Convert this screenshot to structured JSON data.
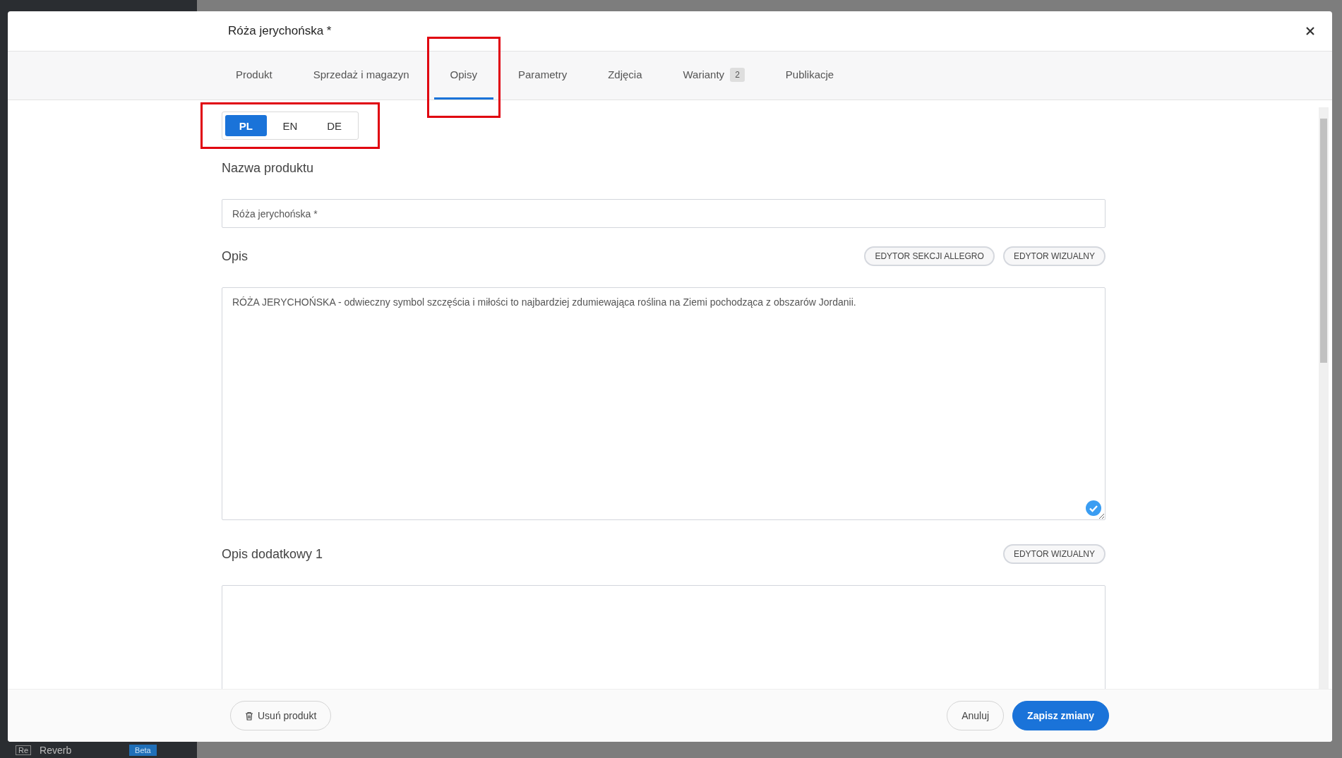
{
  "backdrop": {
    "sidebar_badge": "Re",
    "sidebar_item": "Reverb",
    "sidebar_tag": "Beta"
  },
  "dialog": {
    "title": "Róża jerychońska *"
  },
  "tabs": [
    {
      "label": "Produkt",
      "selected": false
    },
    {
      "label": "Sprzedaż i magazyn",
      "selected": false
    },
    {
      "label": "Opisy",
      "selected": true,
      "highlighted": true
    },
    {
      "label": "Parametry",
      "selected": false
    },
    {
      "label": "Zdjęcia",
      "selected": false
    },
    {
      "label": "Warianty",
      "selected": false,
      "badge": "2"
    },
    {
      "label": "Publikacje",
      "selected": false
    }
  ],
  "languages": {
    "highlighted": true,
    "items": [
      {
        "label": "PL",
        "selected": true
      },
      {
        "label": "EN",
        "selected": false
      },
      {
        "label": "DE",
        "selected": false
      }
    ]
  },
  "sections": [
    {
      "kind": "input",
      "label": "Nazwa produktu",
      "value": "Róża jerychońska *"
    },
    {
      "kind": "textarea",
      "label": "Opis",
      "buttons": [
        "EDYTOR SEKCJI ALLEGRO",
        "EDYTOR WIZUALNY"
      ],
      "value": "RÓŻA JERYCHOŃSKA - odwieczny symbol szczęścia i miłości to najbardziej zdumiewająca roślina na Ziemi pochodząca z obszarów Jordanii.",
      "validated": true
    },
    {
      "kind": "textarea",
      "label": "Opis dodatkowy 1",
      "buttons": [
        "EDYTOR WIZUALNY"
      ]
    }
  ],
  "footer": {
    "delete": "Usuń produkt",
    "cancel": "Anuluj",
    "save": "Zapisz zmiany"
  }
}
